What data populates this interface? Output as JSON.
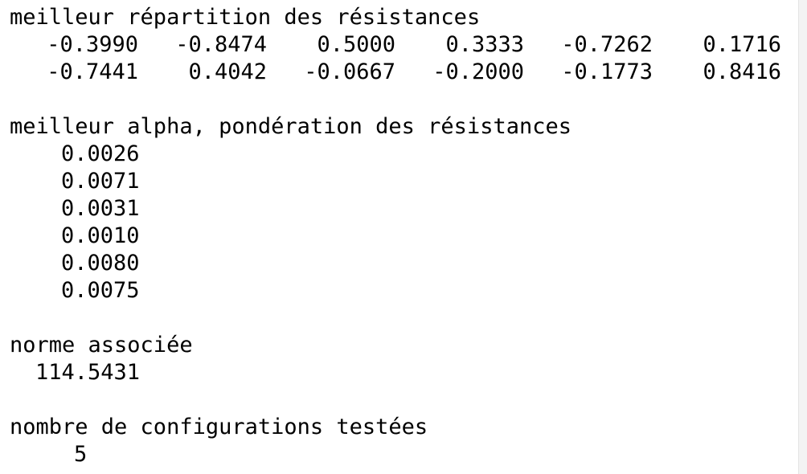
{
  "console": {
    "section_resistances": {
      "heading": "meilleur répartition des résistances",
      "rows": [
        [
          "-0.3990",
          "-0.8474",
          "0.5000",
          "0.3333",
          "-0.7262",
          "0.1716"
        ],
        [
          "-0.7441",
          "0.4042",
          "-0.0667",
          "-0.2000",
          "-0.1773",
          "0.8416"
        ]
      ]
    },
    "section_alpha": {
      "heading": "meilleur alpha, pondération des résistances",
      "values": [
        "0.0026",
        "0.0071",
        "0.0031",
        "0.0010",
        "0.0080",
        "0.0075"
      ]
    },
    "section_norm": {
      "heading": "norme associée",
      "value": "114.5431"
    },
    "section_count": {
      "heading": "nombre de configurations testées",
      "value": "5"
    }
  }
}
